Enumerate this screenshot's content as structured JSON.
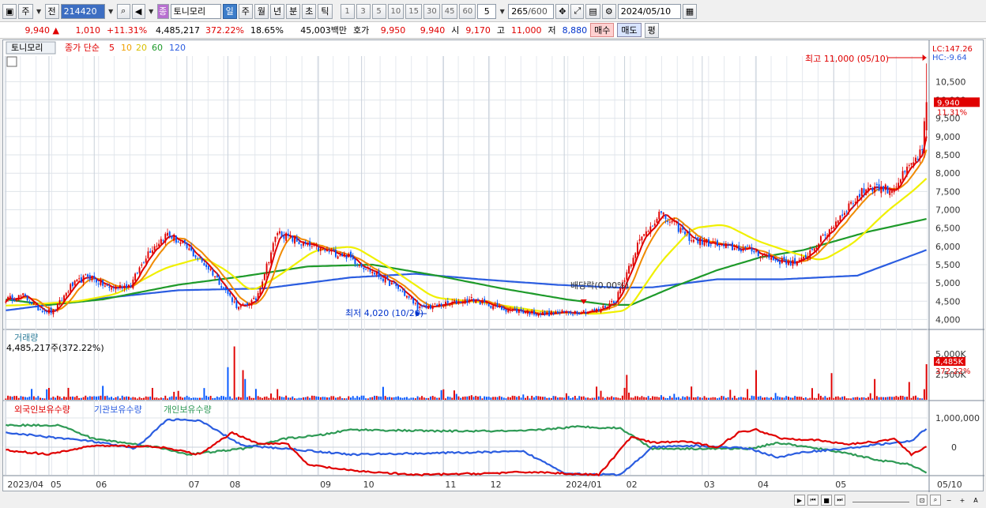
{
  "toolbar": {
    "market": "주",
    "all": "전",
    "code": "214420",
    "stock_badge": "종",
    "stock_name": "토니모리",
    "periods": [
      "일",
      "주",
      "월",
      "년",
      "분",
      "초",
      "틱"
    ],
    "active_period": "일",
    "minute_options": [
      "1",
      "3",
      "5",
      "10",
      "15",
      "30",
      "45",
      "60"
    ],
    "selected_count": "5",
    "display_count": "265",
    "max_count": "/600",
    "date": "2024/05/10"
  },
  "quote": {
    "price": "9,940",
    "change": "1,010",
    "rate": "+11.31%",
    "volume": "4,485,217",
    "vol_ratio": "372.22%",
    "turnover": "18.65%",
    "amount": "45,003백만",
    "bid_label": "호가",
    "ask": "9,950",
    "bid": "9,940",
    "open_label": "시",
    "open": "9,170",
    "high_label": "고",
    "high": "11,000",
    "low_label": "저",
    "low": "8,880",
    "buy_label": "매수",
    "sell_label": "매도",
    "avg_label": "평"
  },
  "colors": {
    "up": "#e00000",
    "down": "#0055ff",
    "ma5": "#e00000",
    "ma10": "#f08a00",
    "ma20": "#f0f000",
    "ma60": "#1e9a2a",
    "ma120": "#2b5de0",
    "foreign": "#e00000",
    "inst": "#2b5de0",
    "indiv": "#2e9a55"
  },
  "chart_data": [
    {
      "type": "candlestick",
      "title": "토니모리",
      "series_label": "종가 단순",
      "ma_periods": [
        "5",
        "10",
        "20",
        "60",
        "120"
      ],
      "corner_labels": {
        "lc": "LC:147.26",
        "hc": "HC:-9.64"
      },
      "last_price_label": "9,940",
      "last_rate_label": "11.31%",
      "annotations": {
        "high": "최고 11,000 (05/10)",
        "low": "최저 4,020 (10/20)",
        "dividend": "배당락(0.00%)"
      },
      "ylim": [
        3750,
        11200
      ],
      "y_ticks": [
        "4,000",
        "4,500",
        "5,000",
        "5,500",
        "6,000",
        "6,500",
        "7,000",
        "7,500",
        "8,000",
        "8,500",
        "9,000",
        "9,500",
        "10,000",
        "10,500"
      ],
      "x_ticks": [
        "2023/04",
        "05",
        "06",
        "07",
        "08",
        "09",
        "10",
        "11",
        "12",
        "2024/01",
        "02",
        "03",
        "04",
        "05",
        "05/10"
      ],
      "close_knots": [
        [
          0,
          4550
        ],
        [
          8,
          4650
        ],
        [
          15,
          4300
        ],
        [
          22,
          4200
        ],
        [
          30,
          4900
        ],
        [
          38,
          5200
        ],
        [
          48,
          4850
        ],
        [
          58,
          4950
        ],
        [
          66,
          5850
        ],
        [
          75,
          6350
        ],
        [
          85,
          5900
        ],
        [
          95,
          5350
        ],
        [
          108,
          4300
        ],
        [
          116,
          4550
        ],
        [
          126,
          6400
        ],
        [
          136,
          6100
        ],
        [
          146,
          5900
        ],
        [
          158,
          5750
        ],
        [
          170,
          5300
        ],
        [
          182,
          4850
        ],
        [
          192,
          4300
        ],
        [
          202,
          4400
        ],
        [
          216,
          4550
        ],
        [
          230,
          4300
        ],
        [
          248,
          4150
        ],
        [
          262,
          4200
        ],
        [
          275,
          4250
        ],
        [
          283,
          4550
        ],
        [
          293,
          6050
        ],
        [
          303,
          6900
        ],
        [
          311,
          6550
        ],
        [
          318,
          6200
        ],
        [
          332,
          6000
        ],
        [
          346,
          5900
        ],
        [
          358,
          5600
        ],
        [
          368,
          5550
        ],
        [
          380,
          6300
        ],
        [
          390,
          7050
        ],
        [
          400,
          7650
        ],
        [
          411,
          7550
        ],
        [
          421,
          8300
        ],
        [
          425,
          8600
        ],
        [
          427,
          9940
        ]
      ],
      "ma20_knots": [
        [
          0,
          4380
        ],
        [
          30,
          4500
        ],
        [
          48,
          4700
        ],
        [
          70,
          5400
        ],
        [
          88,
          5700
        ],
        [
          100,
          5300
        ],
        [
          110,
          4750
        ],
        [
          122,
          5150
        ],
        [
          140,
          5900
        ],
        [
          158,
          6000
        ],
        [
          175,
          5400
        ],
        [
          195,
          4600
        ],
        [
          220,
          4450
        ],
        [
          245,
          4220
        ],
        [
          270,
          4150
        ],
        [
          285,
          4250
        ],
        [
          300,
          5550
        ],
        [
          315,
          6500
        ],
        [
          330,
          6600
        ],
        [
          345,
          6150
        ],
        [
          360,
          5850
        ],
        [
          375,
          5600
        ],
        [
          390,
          6100
        ],
        [
          405,
          6950
        ],
        [
          418,
          7550
        ],
        [
          427,
          8050
        ]
      ],
      "ma60_knots": [
        [
          0,
          4550
        ],
        [
          20,
          4400
        ],
        [
          45,
          4550
        ],
        [
          80,
          4950
        ],
        [
          110,
          5180
        ],
        [
          140,
          5450
        ],
        [
          170,
          5500
        ],
        [
          200,
          5200
        ],
        [
          230,
          4850
        ],
        [
          260,
          4550
        ],
        [
          280,
          4400
        ],
        [
          290,
          4400
        ],
        [
          310,
          4900
        ],
        [
          330,
          5350
        ],
        [
          350,
          5700
        ],
        [
          370,
          5900
        ],
        [
          400,
          6400
        ],
        [
          427,
          6750
        ]
      ],
      "ma120_knots": [
        [
          0,
          4250
        ],
        [
          40,
          4550
        ],
        [
          80,
          4800
        ],
        [
          120,
          4850
        ],
        [
          160,
          5150
        ],
        [
          190,
          5250
        ],
        [
          220,
          5100
        ],
        [
          255,
          4950
        ],
        [
          285,
          4870
        ],
        [
          300,
          4880
        ],
        [
          330,
          5100
        ],
        [
          360,
          5100
        ],
        [
          395,
          5200
        ],
        [
          427,
          5900
        ]
      ],
      "volume": {
        "title": "거래량",
        "value_label": "4,485,217주(372.22%)",
        "y_ticks": [
          "2,500K",
          "5,000K"
        ],
        "last_label": "4,485K",
        "last_rate": "372.22%"
      },
      "holdings": {
        "legend": [
          "외국인보유수량",
          "기관보유수량",
          "개인보유수량"
        ],
        "y_ticks": [
          "1,000,000",
          "0"
        ],
        "foreign_knots": [
          [
            0,
            -0.1
          ],
          [
            20,
            -0.25
          ],
          [
            40,
            0.05
          ],
          [
            70,
            0.02
          ],
          [
            90,
            -0.25
          ],
          [
            105,
            0.5
          ],
          [
            118,
            0.1
          ],
          [
            130,
            0.15
          ],
          [
            140,
            -0.6
          ],
          [
            160,
            -0.8
          ],
          [
            190,
            -0.95
          ],
          [
            220,
            -0.9
          ],
          [
            245,
            -0.85
          ],
          [
            275,
            -0.95
          ],
          [
            290,
            0.35
          ],
          [
            300,
            0.15
          ],
          [
            315,
            0.2
          ],
          [
            330,
            0.0
          ],
          [
            340,
            0.5
          ],
          [
            348,
            0.6
          ],
          [
            360,
            0.3
          ],
          [
            375,
            0.25
          ],
          [
            390,
            0.1
          ],
          [
            405,
            0.2
          ],
          [
            412,
            0.3
          ],
          [
            420,
            -0.25
          ],
          [
            427,
            0.02
          ]
        ],
        "inst_knots": [
          [
            0,
            0.5
          ],
          [
            20,
            0.35
          ],
          [
            40,
            0.2
          ],
          [
            60,
            -0.05
          ],
          [
            75,
            0.95
          ],
          [
            90,
            0.9
          ],
          [
            110,
            0.05
          ],
          [
            130,
            -0.05
          ],
          [
            160,
            -0.25
          ],
          [
            200,
            -0.2
          ],
          [
            240,
            -0.15
          ],
          [
            260,
            -0.9
          ],
          [
            285,
            -0.95
          ],
          [
            300,
            0.0
          ],
          [
            320,
            0.05
          ],
          [
            345,
            -0.05
          ],
          [
            358,
            -0.35
          ],
          [
            372,
            -0.15
          ],
          [
            390,
            -0.05
          ],
          [
            405,
            0.1
          ],
          [
            420,
            0.2
          ],
          [
            427,
            0.65
          ]
        ],
        "indiv_knots": [
          [
            0,
            0.75
          ],
          [
            25,
            0.75
          ],
          [
            40,
            0.3
          ],
          [
            70,
            0.0
          ],
          [
            85,
            -0.25
          ],
          [
            110,
            -0.05
          ],
          [
            130,
            0.3
          ],
          [
            145,
            0.4
          ],
          [
            160,
            0.6
          ],
          [
            200,
            0.55
          ],
          [
            240,
            0.55
          ],
          [
            265,
            0.7
          ],
          [
            285,
            0.65
          ],
          [
            300,
            -0.05
          ],
          [
            320,
            -0.05
          ],
          [
            345,
            -0.05
          ],
          [
            358,
            0.15
          ],
          [
            372,
            0.0
          ],
          [
            390,
            -0.2
          ],
          [
            405,
            -0.45
          ],
          [
            420,
            -0.6
          ],
          [
            427,
            -0.9
          ]
        ]
      }
    }
  ],
  "bottom": {
    "buttons": [
      "▶",
      "⏮",
      "■",
      "⏭"
    ],
    "zoom": [
      "−",
      "+",
      "A"
    ]
  }
}
